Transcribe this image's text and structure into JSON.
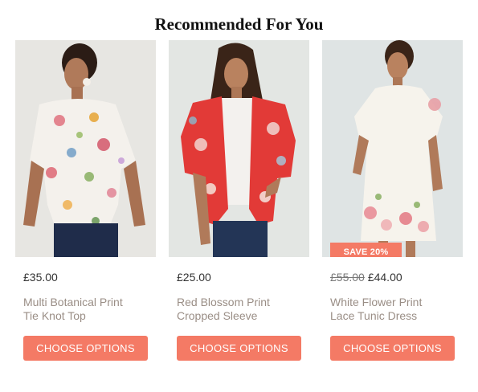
{
  "section": {
    "heading": "Recommended For You"
  },
  "products": [
    {
      "name_line1": "Multi Botanical Print",
      "name_line2": "Tie Knot Top",
      "price": "£35.00",
      "button_label": "CHOOSE OPTIONS",
      "image": "woman-in-floral-tie-knot-top"
    },
    {
      "name_line1": "Red Blossom Print",
      "name_line2": "Cropped Sleeve",
      "price": "£25.00",
      "button_label": "CHOOSE OPTIONS",
      "image": "woman-in-red-floral-kimono"
    },
    {
      "name_line1": "White Flower Print",
      "name_line2": "Lace Tunic Dress",
      "badge": "SAVE 20%",
      "old_price": "£55.00",
      "price": "£44.00",
      "button_label": "CHOOSE OPTIONS",
      "image": "woman-in-white-lace-floral-dress"
    }
  ],
  "colors": {
    "accent": "#f47a65",
    "title": "#9a8e86",
    "text": "#333333"
  }
}
